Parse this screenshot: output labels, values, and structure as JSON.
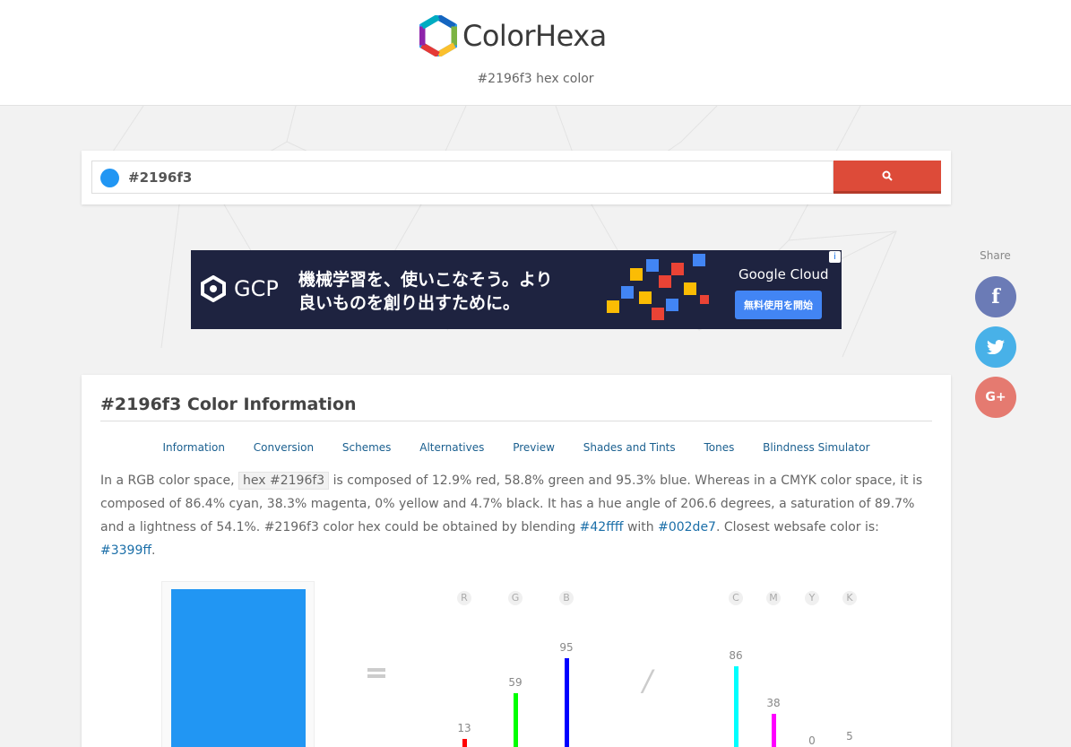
{
  "header": {
    "brand_part1": "Color",
    "brand_part2": "Hexa",
    "subtitle": "#2196f3 hex color"
  },
  "search": {
    "value": "#2196f3",
    "swatch_color": "#2196f3",
    "button_icon": "search-icon"
  },
  "ad": {
    "brand": "GCP",
    "copy_line1": "機械学習を、使いこなそう。より",
    "copy_line2": "良いものを創り出すために。",
    "google_cloud": "Google Cloud",
    "cta": "無料使用を開始",
    "info": "i"
  },
  "share": {
    "label": "Share",
    "facebook": "f",
    "googleplus": "G+"
  },
  "main": {
    "title": "#2196f3 Color Information",
    "tabs": [
      "Information",
      "Conversion",
      "Schemes",
      "Alternatives",
      "Preview",
      "Shades and Tints",
      "Tones",
      "Blindness Simulator"
    ],
    "desc": {
      "t1": "In a RGB color space, ",
      "code": "hex #2196f3",
      "t2": " is composed of 12.9% red, 58.8% green and 95.3% blue. Whereas in a CMYK color space, it is composed of 86.4% cyan, 38.3% magenta, 0% yellow and 4.7% black. It has a hue angle of 206.6 degrees, a saturation of 89.7% and a lightness of 54.1%. #2196f3 color hex could be obtained by blending ",
      "link1": "#42ffff",
      "t3": " with ",
      "link2": "#002de7",
      "t4": ". Closest websafe color is: ",
      "link3": "#3399ff",
      "t5": "."
    }
  },
  "rgb": {
    "labels": [
      "R",
      "G",
      "B"
    ],
    "values": [
      13,
      59,
      95
    ],
    "colors": [
      "#ff0000",
      "#00ff00",
      "#0000ff"
    ]
  },
  "cmyk": {
    "labels": [
      "C",
      "M",
      "Y",
      "K"
    ],
    "values": [
      86,
      38,
      0,
      5
    ],
    "colors": [
      "#00ffff",
      "#ff00ff",
      "#ffff00",
      "#000000"
    ]
  }
}
